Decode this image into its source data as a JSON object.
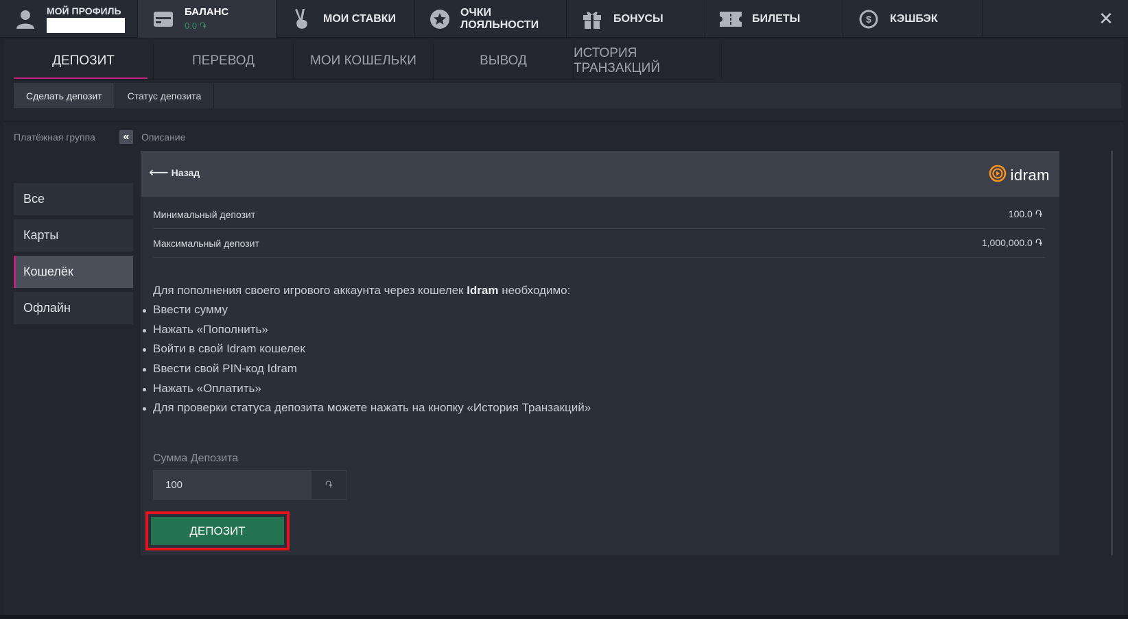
{
  "topnav": {
    "profile_label": "МОЙ ПРОФИЛЬ",
    "balance_label": "БАЛАНС",
    "balance_value": "0.0 ֏",
    "items": [
      {
        "label": "МОИ СТАВКИ",
        "icon": "victory-hand-icon"
      },
      {
        "label": "ОЧКИ ЛОЯЛЬНОСТИ",
        "icon": "star-icon"
      },
      {
        "label": "БОНУСЫ",
        "icon": "gift-icon"
      },
      {
        "label": "БИЛЕТЫ",
        "icon": "ticket-icon"
      },
      {
        "label": "КЭШБЭК",
        "icon": "cashback-icon"
      }
    ],
    "close": "✕"
  },
  "tabs": [
    {
      "label": "ДЕПОЗИТ",
      "active": true
    },
    {
      "label": "ПЕРЕВОД"
    },
    {
      "label": "МОИ КОШЕЛЬКИ"
    },
    {
      "label": "ВЫВОД"
    },
    {
      "label": "ИСТОРИЯ ТРАНЗАКЦИЙ"
    }
  ],
  "subtabs": [
    {
      "label": "Сделать депозит",
      "active": true
    },
    {
      "label": "Статус депозита"
    }
  ],
  "sidebar": {
    "title": "Платёжная группа",
    "collapse": "«",
    "items": [
      {
        "label": "Все"
      },
      {
        "label": "Карты"
      },
      {
        "label": "Кошелёк",
        "active": true
      },
      {
        "label": "Офлайн"
      }
    ]
  },
  "content": {
    "section_title": "Описание",
    "back_label": "Назад",
    "logo_text": "idram",
    "min_label": "Минимальный депозит",
    "min_value": "100.0 ֏",
    "max_label": "Максимальный депозит",
    "max_value": "1,000,000.0 ֏",
    "intro_before": "Для пополнения своего игрового аккаунта через кошелек ",
    "intro_bold": "Idram",
    "intro_after": " необходимо:",
    "steps": [
      "Ввести сумму",
      "Нажать «Пополнить»",
      "Войти в свой Idram кошелек",
      "Ввести свой PIN-код Idram",
      "Нажать «Оплатить»",
      "Для проверки статуса депозита можете нажать на кнопку «История Транзакций»"
    ],
    "amount_label": "Сумма Депозита",
    "amount_value": "100",
    "currency": "֏",
    "deposit_button": "ДЕПОЗИТ"
  },
  "colors": {
    "accent": "#c0247a",
    "deposit_button": "#247451",
    "highlight_border": "#e5141f",
    "logo_orange": "#f7931e"
  }
}
